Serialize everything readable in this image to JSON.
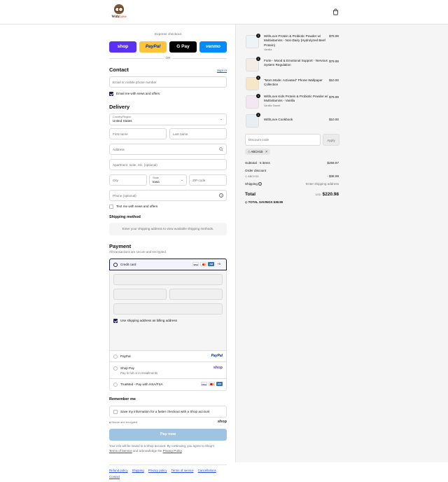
{
  "brand": {
    "name_part1": "With",
    "name_part2": "Love"
  },
  "express": {
    "title": "Express checkout",
    "buttons": [
      {
        "label": "shop",
        "color": "#5a31f4"
      },
      {
        "label": "PayPal",
        "color": "#ffc439"
      },
      {
        "label": "G Pay",
        "color": "#000000"
      },
      {
        "label": "venmo",
        "color": "#008cff"
      }
    ],
    "or": "OR"
  },
  "contact": {
    "title": "Contact",
    "signin": "Sign in",
    "email_placeholder": "Email or mobile phone number",
    "news_label": "Email me with news and offers"
  },
  "delivery": {
    "title": "Delivery",
    "country_label": "Country/Region",
    "country_value": "United States",
    "first_name": "First name",
    "last_name": "Last name",
    "address": "Address",
    "apartment": "Apartment, suite, etc. (optional)",
    "city": "City",
    "state_label": "State",
    "state_value": "Iowa",
    "zip": "ZIP code",
    "phone": "Phone (optional)",
    "text_label": "Text me with news and offers"
  },
  "shipping_method": {
    "title": "Shipping method",
    "message": "Enter your shipping address to view available shipping methods."
  },
  "payment": {
    "title": "Payment",
    "subtitle": "All transactions are secure and encrypted.",
    "credit_card": "Credit card",
    "more_cards": "+5",
    "billing_label": "Use shipping address as billing address",
    "paypal": "PayPal",
    "shop_pay": "Shop Pay",
    "shop_pay_sub": "Pay in full or in installments",
    "truemed": "TrueMed - Pay with HSA/FSA"
  },
  "remember": {
    "title": "Remember me",
    "label": "Save my information for a faster checkout with a Shop account",
    "secure": "Secure and encrypted",
    "shop": "shop"
  },
  "pay_now": "Pay now",
  "disclaimer": {
    "line1": "Your info will be saved to a Shop account. By continuing, you agree to Shop's",
    "terms": "Terms of Service",
    "and": "and acknowledge the",
    "privacy": "Privacy Policy"
  },
  "footer_links": [
    "Refund policy",
    "Shipping",
    "Privacy policy",
    "Terms of service",
    "Cancellations",
    "Contact"
  ],
  "cart": {
    "items": [
      {
        "qty": "1",
        "name": "WithLove Protein & Probiotic Powder w/ Multivitamins - Non-Dairy (Hydrolyzed Beef Protein)",
        "variant": "Vanilla",
        "price": "$79.99"
      },
      {
        "qty": "1",
        "name": "Forte - Mood & Emotional Support - Nervous System Regulation",
        "variant": "",
        "price": "$79.99"
      },
      {
        "qty": "1",
        "name": "\"Mom Mode: Activated\" Phone Wallpaper Collection",
        "variant": "",
        "price": "$10.00"
      },
      {
        "qty": "1",
        "name": "WithLove Kids Protein & Probiotic Powder w/ Multivitamins - Vanilla",
        "variant": "Vanilla Sweet",
        "price": "$79.99"
      },
      {
        "qty": "1",
        "name": "WithLove Cookbook",
        "variant": "",
        "price": "$10.00"
      }
    ],
    "discount_placeholder": "Discount code",
    "apply": "Apply",
    "applied_code": "ABCH15",
    "subtotal_label": "Subtotal · 5 items",
    "subtotal_value": "$259.97",
    "order_discount_label": "Order discount",
    "discount_code": "ABCH15",
    "discount_value": "- $38.99",
    "shipping_label": "Shipping",
    "shipping_value": "Enter shipping address",
    "total_label": "Total",
    "currency": "USD",
    "total_value": "$220.98",
    "savings_label": "TOTAL SAVINGS",
    "savings_value": "$38.99"
  }
}
